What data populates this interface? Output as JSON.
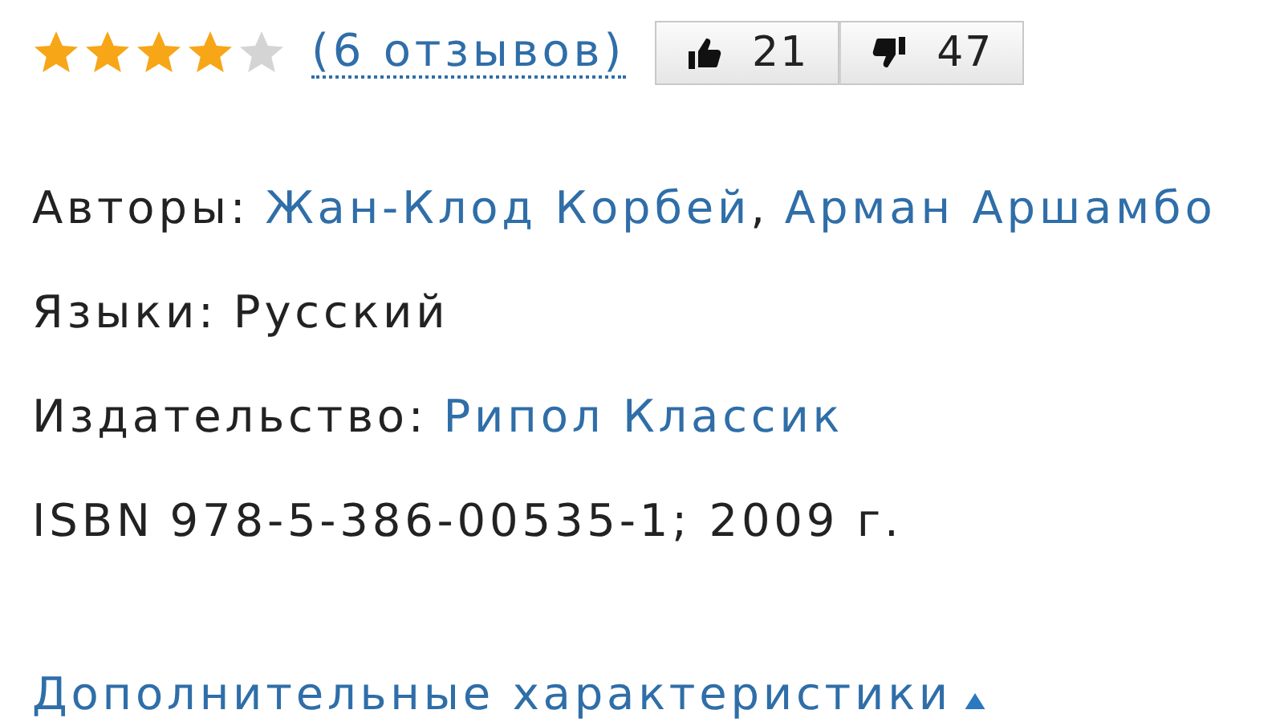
{
  "rating": {
    "stars": 4,
    "reviews_link": "(6 отзывов)"
  },
  "votes": [
    {
      "kind": "up",
      "count": "21"
    },
    {
      "kind": "down",
      "count": "47"
    }
  ],
  "fields": [
    {
      "label": "Авторы:",
      "values": [
        {
          "text": "Жан-Клод Корбей",
          "kind": "link"
        },
        {
          "text": ",",
          "kind": "plain"
        },
        {
          "text": "Арман Аршамбо",
          "kind": "link"
        }
      ]
    },
    {
      "label": "Языки:",
      "values": [
        {
          "text": "Русский",
          "kind": "plain"
        }
      ]
    },
    {
      "label": "Издательство:",
      "values": [
        {
          "text": "Рипол Классик",
          "kind": "link"
        }
      ]
    },
    {
      "label": "ISBN",
      "values": [
        {
          "text": "978-5-386-00535-1; 2009 г.",
          "kind": "plain"
        }
      ]
    }
  ],
  "more_link": {
    "text": "Дополнительные характеристики",
    "expanded": true
  }
}
